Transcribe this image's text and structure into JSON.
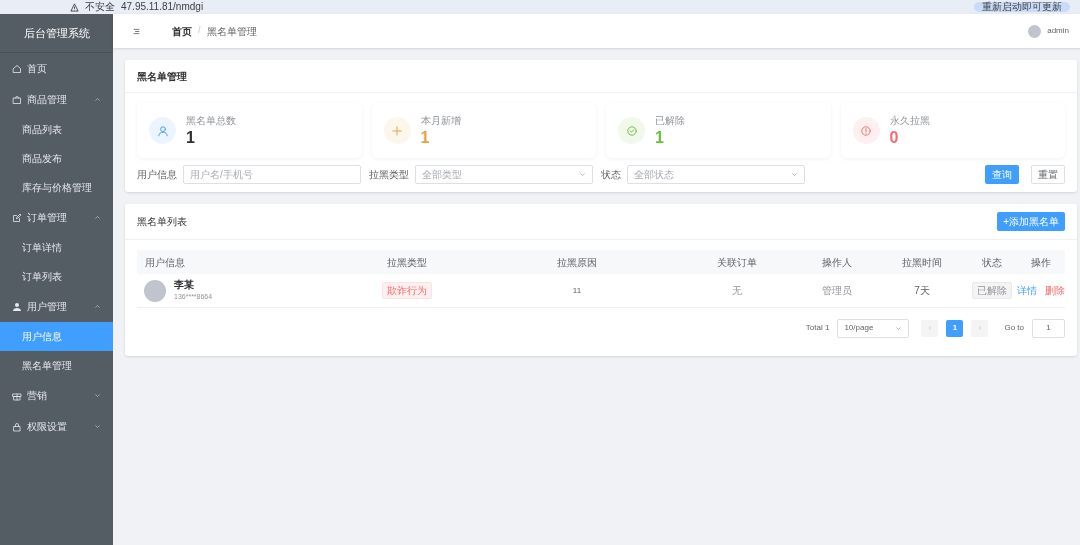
{
  "browser": {
    "security": "不安全",
    "url": "47.95.11.81/nmdgi",
    "update": "重新启动即可更新"
  },
  "sidebar": {
    "title": "后台管理系统",
    "items": [
      {
        "label": "首页",
        "selected": false
      },
      {
        "label": "商品管理",
        "expanded": true,
        "children": [
          {
            "label": "商品列表",
            "selected": false
          },
          {
            "label": "商品发布",
            "selected": false
          },
          {
            "label": "库存与价格管理",
            "selected": false
          }
        ]
      },
      {
        "label": "订单管理",
        "expanded": true,
        "children": [
          {
            "label": "订单详情",
            "selected": false
          },
          {
            "label": "订单列表",
            "selected": false
          }
        ]
      },
      {
        "label": "用户管理",
        "expanded": true,
        "children": [
          {
            "label": "用户信息",
            "selected": true
          },
          {
            "label": "黑名单管理",
            "selected": false
          }
        ]
      },
      {
        "label": "营销",
        "expanded": false
      },
      {
        "label": "权限设置",
        "expanded": false
      }
    ]
  },
  "header": {
    "breadcrumb": [
      "首页",
      "黑名单管理"
    ],
    "separator": "/",
    "user": "admin"
  },
  "panel": {
    "title": "黑名单管理",
    "stats": [
      {
        "label": "黑名单总数",
        "value": "1",
        "color": "#303133"
      },
      {
        "label": "本月新增",
        "value": "1",
        "color": "#e6a23c"
      },
      {
        "label": "已解除",
        "value": "1",
        "color": "#67c23a"
      },
      {
        "label": "永久拉黑",
        "value": "0",
        "color": "#f56c6c"
      }
    ],
    "filters": [
      {
        "label": "用户信息",
        "kind": "input",
        "placeholder": "用户名/手机号"
      },
      {
        "label": "拉黑类型",
        "kind": "select",
        "placeholder": "全部类型"
      },
      {
        "label": "状态",
        "kind": "select",
        "placeholder": "全部状态"
      }
    ],
    "search_button": "查询",
    "reset_button": "重置"
  },
  "list": {
    "title": "黑名单列表",
    "add_button": "+添加黑名单",
    "columns": [
      "用户信息",
      "拉黑类型",
      "拉黑原因",
      "关联订单",
      "操作人",
      "拉黑时间",
      "状态",
      "操作"
    ],
    "rows": [
      {
        "name": "李某",
        "phone": "136****8664",
        "type": "欺诈行为",
        "reason": "11",
        "order": "无",
        "operator": "管理员",
        "time": "7天",
        "status": "已解除",
        "actions": [
          "详情",
          "删除"
        ]
      }
    ],
    "pagination": {
      "total": "Total 1",
      "page_size": "10/page",
      "pages": [
        {
          "label": "1",
          "selected": true
        }
      ],
      "goto": "Go to",
      "goto_value": "1"
    }
  }
}
